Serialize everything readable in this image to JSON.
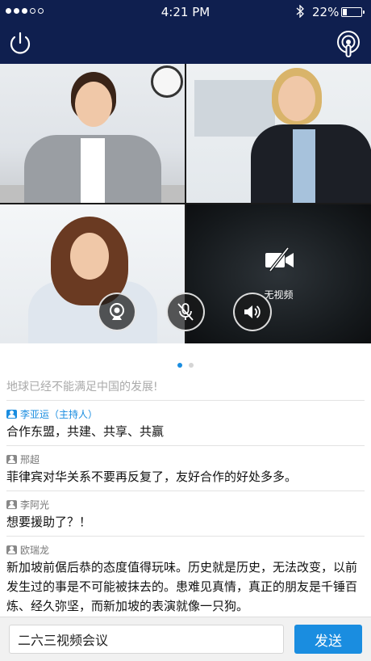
{
  "status_bar": {
    "time": "4:21 PM",
    "battery_text": "22%",
    "battery_level": 0.22,
    "signal_filled": 3,
    "signal_total": 5
  },
  "header": {
    "left_icon": "power-icon",
    "right_icon": "podcast-icon",
    "color": "#0f1f4f"
  },
  "video": {
    "no_video_label": "无视频",
    "controls": [
      "camera-icon",
      "mic-muted-icon",
      "speaker-icon"
    ]
  },
  "pager": {
    "total": 2,
    "active": 0
  },
  "chat": {
    "partial": "地球已经不能满足中国的发展!",
    "messages": [
      {
        "sender": "李亚运（主持人）",
        "text": "合作东盟，共建、共享、共赢"
      },
      {
        "sender": "邢超",
        "text": "菲律宾对华关系不要再反复了，友好合作的好处多多。"
      },
      {
        "sender": "李阿光",
        "text": "想要援助了？！"
      },
      {
        "sender": "欧瑞龙",
        "text": "新加坡前倨后恭的态度值得玩味。历史就是历史，无法改变，以前发生过的事是不可能被抹去的。患难见真情，真正的朋友是千锤百炼、经久弥坚，而新加坡的表演就像一只狗。"
      }
    ]
  },
  "input": {
    "value": "二六三视频会议",
    "send_label": "发送"
  },
  "colors": {
    "accent": "#1a8de0",
    "header": "#0f1f4f"
  }
}
